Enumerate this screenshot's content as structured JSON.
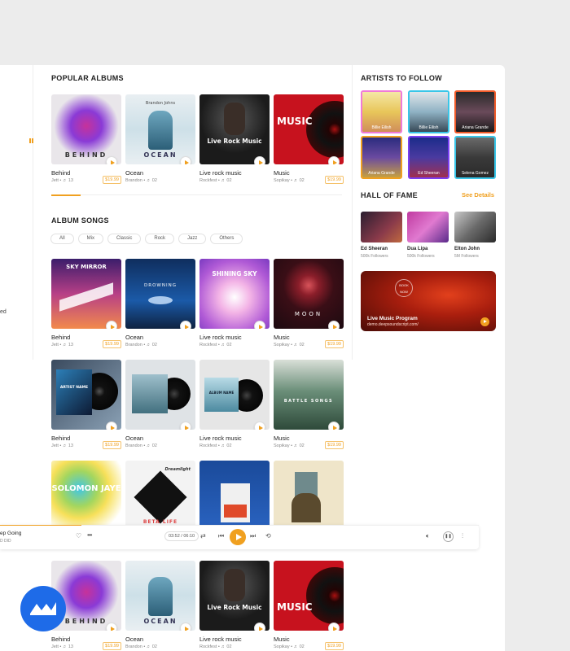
{
  "sidebar": {
    "partial_text": "ed"
  },
  "popular_albums": {
    "title": "POPULAR ALBUMS",
    "items": [
      {
        "title": "Behind",
        "meta": "Jett  •  ♬ 13",
        "price": "$19.99",
        "cover_text": "BEHIND"
      },
      {
        "title": "Ocean",
        "meta": "Brandon  •  ♬ 02",
        "price": "",
        "cover_text": "OCEAN",
        "cover_subtext": "Brandon Johns"
      },
      {
        "title": "Live rock music",
        "meta": "Rockfest  •  ♬ 02",
        "price": "",
        "cover_text": "Live Rock Music"
      },
      {
        "title": "Music",
        "meta": "Sopikay  •  ♬ 02",
        "price": "$19.99",
        "cover_text": "MUSIC"
      }
    ]
  },
  "album_songs": {
    "title": "ALBUM SONGS",
    "filters": [
      "All",
      "Mix",
      "Classic",
      "Rock",
      "Jazz",
      "Others"
    ],
    "row1": [
      {
        "title": "Behind",
        "meta": "Jett  •  ♬ 13",
        "price": "$19.99",
        "cover_text": "SKY MIRROR"
      },
      {
        "title": "Ocean",
        "meta": "Brandon  •  ♬ 02",
        "price": "",
        "cover_text": "DROWNING"
      },
      {
        "title": "Live rock music",
        "meta": "Rockfest  •  ♬ 02",
        "price": "",
        "cover_text": "SHINING SKY"
      },
      {
        "title": "Music",
        "meta": "Sopikay  •  ♬ 02",
        "price": "$19.99",
        "cover_text": "MOON"
      }
    ],
    "row2": [
      {
        "title": "Behind",
        "meta": "Jett  •  ♬ 13",
        "price": "$19.99",
        "cover_text": "ARTIST NAME"
      },
      {
        "title": "Ocean",
        "meta": "Brandon  •  ♬ 02",
        "price": ""
      },
      {
        "title": "Live rock music",
        "meta": "Rockfest  •  ♬ 02",
        "price": "",
        "cover_text": "ALBUM NAME"
      },
      {
        "title": "Music",
        "meta": "Sopikay  •  ♬ 02",
        "price": "$19.99",
        "cover_text": "BATTLE SONGS"
      }
    ],
    "row3": [
      {
        "cover_text": "SOLOMON JAYE"
      },
      {
        "cover_text": "BETA LIFE",
        "cover_subtext": "Dreamlight"
      },
      {
        "cover_text": ""
      },
      {
        "cover_text": ""
      }
    ],
    "row4": [
      {
        "title": "Behind",
        "meta": "Jett  •  ♬ 13",
        "price": "$19.99",
        "cover_text": "BEHIND"
      },
      {
        "title": "Ocean",
        "meta": "Brandon  •  ♬ 02",
        "price": "",
        "cover_text": "OCEAN"
      },
      {
        "title": "Live rock music",
        "meta": "Rockfest  •  ♬ 02",
        "price": "",
        "cover_text": "Live Rock Music"
      },
      {
        "title": "Music",
        "meta": "Sopikay  •  ♬ 02",
        "price": "$19.99",
        "cover_text": "MUSIC"
      }
    ]
  },
  "artists_to_follow": {
    "title": "ARTISTS TO FOLLOW",
    "items": [
      {
        "name": "Billie Eilish",
        "border": "#f07ad8"
      },
      {
        "name": "Billie Eilish",
        "border": "#39c6e8"
      },
      {
        "name": "Ariana Grande",
        "border": "#f05b2a"
      },
      {
        "name": "Ariana Grande",
        "border": "#f0a020"
      },
      {
        "name": "Ed Sheeran",
        "border": "#7b3ff2"
      },
      {
        "name": "Selena Gomez",
        "border": "#39c6e8"
      }
    ]
  },
  "hall_of_fame": {
    "title": "HALL OF FAME",
    "see_details": "See Details",
    "items": [
      {
        "name": "Ed Sheeran",
        "followers": "500k Followers"
      },
      {
        "name": "Dua Lipa",
        "followers": "500k Followers"
      },
      {
        "name": "Elton John",
        "followers": "5M Followers"
      }
    ]
  },
  "banner": {
    "book": "BOOK NOW",
    "title": "Live Music Program",
    "url": "demo.deepsoundscript.com/"
  },
  "player": {
    "title": "ep Going",
    "subtitle": "D DID",
    "time": "03:52 / 06:10",
    "progress": 0.17
  },
  "colors": {
    "accent": "#f0a020"
  }
}
